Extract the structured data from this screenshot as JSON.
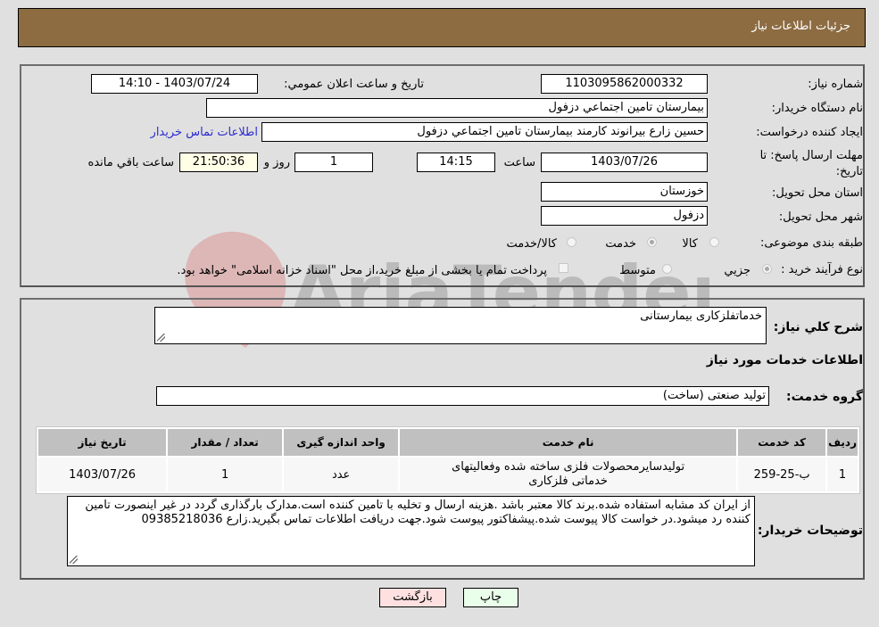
{
  "header": {
    "title": "جزئیات اطلاعات نیاز"
  },
  "info": {
    "need_number_label": "شماره نیاز:",
    "need_number": "1103095862000332",
    "announce_label": "تاریخ و ساعت اعلان عمومي:",
    "announce_value": "1403/07/24 - 14:10",
    "buyer_org_label": "نام دستگاه خريدار:",
    "buyer_org": "بيمارستان تامين اجتماعي دزفول",
    "creator_label": "ايجاد کننده درخواست:",
    "creator": "حسين زارع بيرانوند کارمند بيمارستان تامين اجتماعي دزفول",
    "contact_link": "اطلاعات تماس خريدار",
    "deadline_label": "مهلت ارسال پاسخ: تا تاريخ:",
    "deadline_date": "1403/07/26",
    "time_label": "ساعت",
    "deadline_time": "14:15",
    "days": "1",
    "days_label": "روز و",
    "remaining": "21:50:36",
    "remaining_label": "ساعت باقي مانده",
    "province_label": "استان محل تحويل:",
    "province": "خوزستان",
    "city_label": "شهر محل تحويل:",
    "city": "دزفول",
    "category_label": "طبقه بندی موضوعی:",
    "category_options": [
      {
        "label": "کالا",
        "selected": false
      },
      {
        "label": "خدمت",
        "selected": true
      },
      {
        "label": "کالا/خدمت",
        "selected": false
      }
    ],
    "process_label": "نوع فرآيند خريد :",
    "process_options": [
      {
        "label": "جزيي",
        "selected": true
      },
      {
        "label": "متوسط",
        "selected": false
      }
    ],
    "treasury_note": "پرداخت تمام يا بخشی از مبلغ خريد،از محل \"اسناد خزانه اسلامی\" خواهد بود."
  },
  "details": {
    "summary_label": "شرح کلي نياز:",
    "summary": "خدماتفلزکاری بیمارستانی",
    "services_title": "اطلاعات خدمات مورد نياز",
    "service_group_label": "گروه خدمت:",
    "service_group": "تولید صنعتی (ساخت)",
    "table": {
      "headers": [
        "رديف",
        "کد خدمت",
        "نام خدمت",
        "واحد اندازه گيری",
        "تعداد / مقدار",
        "تاريخ نياز"
      ],
      "rows": [
        [
          "1",
          "ب-25-259",
          "تولیدسایرمحصولات فلزی ساخته شده وفعالیتهای خدماتی فلزکاری",
          "عدد",
          "1",
          "1403/07/26"
        ]
      ]
    },
    "buyer_notes_label": "توضيحات خريدار:",
    "buyer_notes": "از ایران کد مشابه استفاده شده.برند کالا معتبر باشد .هزینه ارسال و تخلیه با تامین کننده است.مدارک بارگذاری گردد در غیر اینصورت تامین کننده رد میشود.در خواست کالا پیوست شده.پیشفاکتور پیوست شود.جهت دریافت اطلاعات تماس بگیرید.زارع 09385218036"
  },
  "buttons": {
    "print": "چاپ",
    "back": "بازگشت"
  },
  "colors": {
    "header_bg": "#8d6c42",
    "print_bg": "#eaffea",
    "back_bg": "#ffe0e0"
  },
  "watermark": {
    "text": "AriaTender.neT"
  }
}
